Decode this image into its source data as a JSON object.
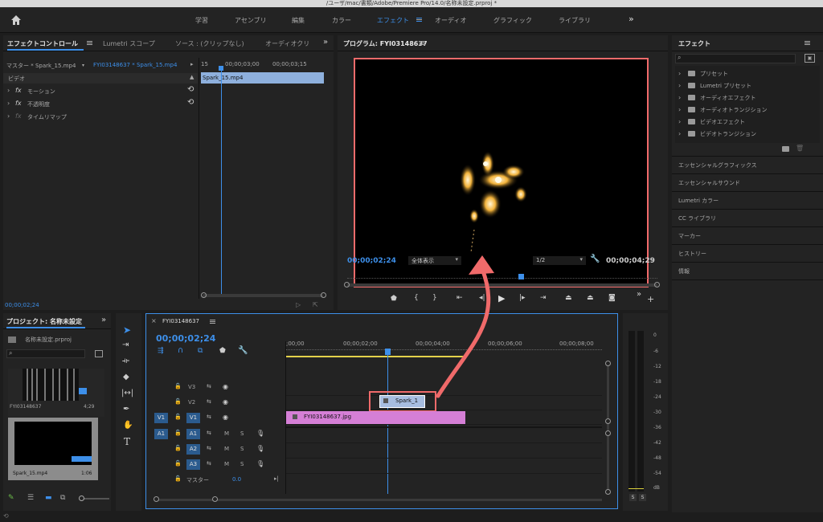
{
  "window": {
    "title": "/ユーザ/mac/書類/Adobe/Premiere Pro/14.0/名称未設定.prproj *"
  },
  "workspaces": {
    "items": [
      "学習",
      "アセンブリ",
      "編集",
      "カラー",
      "エフェクト",
      "オーディオ",
      "グラフィック",
      "ライブラリ"
    ],
    "active": "エフェクト",
    "more": "»"
  },
  "effect_controls": {
    "tabs": [
      "エフェクトコントロール",
      "Lumetri スコープ",
      "ソース : (クリップなし)",
      "オーディオクリ"
    ],
    "master": "マスター * Spark_15.mp4",
    "sequence_clip": "FYI03148637 * Spark_15.mp4",
    "ruler_labels": [
      "15",
      "00;00;03;00",
      "00;00;03;15"
    ],
    "clip_label": "Spark_15.mp4",
    "section": "ビデオ",
    "effects": [
      "モーション",
      "不透明度",
      "タイムリマップ"
    ],
    "timecode": "00;00;02;24"
  },
  "program": {
    "title": "プログラム: FYI03148637",
    "timecode_left": "00;00;02;24",
    "fit": "全体表示",
    "resolution": "1/2",
    "timecode_right": "00;00;04;29"
  },
  "effects_panel": {
    "title": "エフェクト",
    "tree": [
      "プリセット",
      "Lumetri プリセット",
      "オーディオエフェクト",
      "オーディオトランジション",
      "ビデオエフェクト",
      "ビデオトランジション"
    ],
    "sections": [
      "エッセンシャルグラフィックス",
      "エッセンシャルサウンド",
      "Lumetri カラー",
      "CC ライブラリ",
      "マーカー",
      "ヒストリー",
      "情報"
    ]
  },
  "project": {
    "title": "プロジェクト: 名称未設定",
    "file": "名称未設定.prproj",
    "items": [
      {
        "name": "FYI03148637",
        "duration": "4;29"
      },
      {
        "name": "Spark_15.mp4",
        "duration": "1:06"
      }
    ]
  },
  "timeline": {
    "sequence": "FYI03148637",
    "timecode": "00;00;02;24",
    "ruler": [
      ";00;00",
      "00;00;02;00",
      "00;00;04;00",
      "00;00;06;00",
      "00;00;08;00"
    ],
    "video_tracks": [
      "V3",
      "V2",
      "V1"
    ],
    "audio_tracks": [
      "A1",
      "A2",
      "A3"
    ],
    "source_v": "V1",
    "source_a": "A1",
    "master_label": "マスター",
    "master_value": "0.0",
    "clip_v2": "Spark_1",
    "clip_v1": "FYI03148637.jpg",
    "m": "M",
    "s": "S"
  },
  "vu": {
    "ticks": [
      "0",
      "-6",
      "-12",
      "-18",
      "-24",
      "-30",
      "-36",
      "-42",
      "-48",
      "-54",
      "dB"
    ],
    "solo": [
      "S",
      "S"
    ]
  },
  "colors": {
    "accent": "#3d8fe9",
    "highlight": "#f06a6a",
    "clip_video": "#d57fd6",
    "clip_spark": "#a7bde0"
  }
}
